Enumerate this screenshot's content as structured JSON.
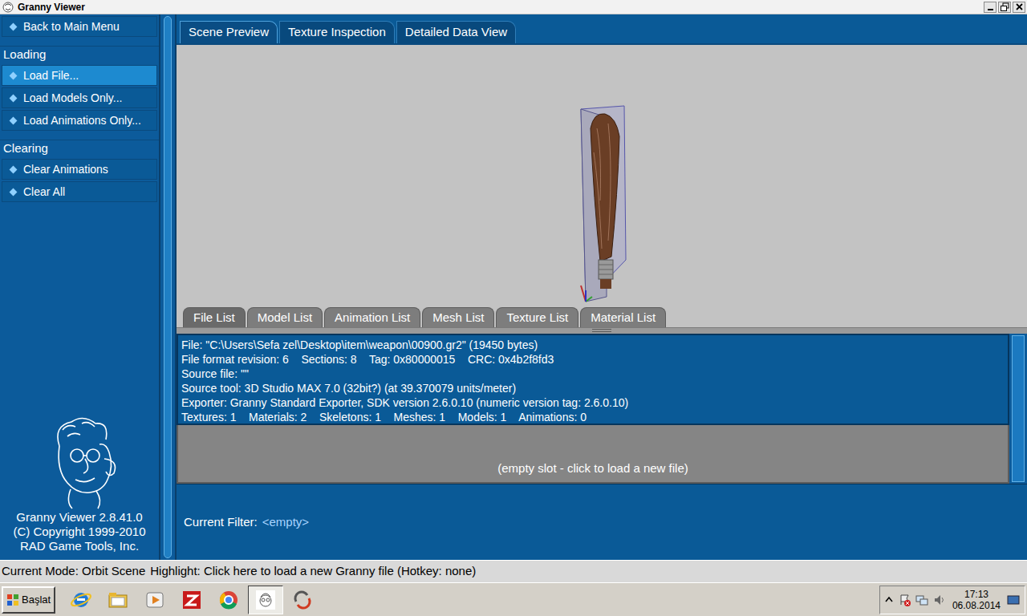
{
  "window": {
    "title": "Granny Viewer"
  },
  "sidebar": {
    "top": [
      {
        "label": "Back to Main Menu",
        "selected": false
      }
    ],
    "sections": [
      {
        "title": "Loading",
        "items": [
          {
            "label": "Load File...",
            "selected": true
          },
          {
            "label": "Load Models Only...",
            "selected": false
          },
          {
            "label": "Load Animations Only...",
            "selected": false
          }
        ]
      },
      {
        "title": "Clearing",
        "items": [
          {
            "label": "Clear Animations",
            "selected": false
          },
          {
            "label": "Clear All",
            "selected": false
          }
        ]
      }
    ],
    "about": [
      "Granny Viewer 2.8.41.0",
      "(C) Copyright 1999-2010",
      "RAD Game Tools, Inc."
    ]
  },
  "view_tabs": [
    {
      "label": "Scene Preview",
      "selected": true
    },
    {
      "label": "Texture Inspection",
      "selected": false
    },
    {
      "label": "Detailed Data View",
      "selected": false
    }
  ],
  "list_tabs": [
    {
      "label": "File List",
      "selected": true
    },
    {
      "label": "Model List",
      "selected": false
    },
    {
      "label": "Animation List",
      "selected": false
    },
    {
      "label": "Mesh List",
      "selected": false
    },
    {
      "label": "Texture List",
      "selected": false
    },
    {
      "label": "Material List",
      "selected": false
    }
  ],
  "file_info": [
    "File: \"C:\\Users\\Sefa zel\\Desktop\\item\\weapon\\00900.gr2\" (19450 bytes)",
    "File format revision: 6    Sections: 8    Tag: 0x80000015    CRC: 0x4b2f8fd3",
    "Source file: \"\"",
    "Source tool: 3D Studio MAX 7.0 (32bit?) (at 39.370079 units/meter)",
    "Exporter: Granny Standard Exporter, SDK version 2.6.0.10 (numeric version tag: 2.6.0.10)",
    "Textures: 1    Materials: 2    Skeletons: 1    Meshes: 1    Models: 1    Animations: 0"
  ],
  "empty_slot": "(empty slot - click to load a new file)",
  "filter": {
    "label": "Current Filter:",
    "value": "<empty>"
  },
  "status_bar": {
    "mode": "Current Mode: Orbit Scene",
    "highlight": "Highlight: Click here to load a new Granny file (Hotkey: none)"
  },
  "taskbar": {
    "start": "Başlat",
    "apps": [
      {
        "kind": "ie",
        "selected": false
      },
      {
        "kind": "explorer",
        "selected": false
      },
      {
        "kind": "media",
        "selected": false
      },
      {
        "kind": "filezilla",
        "selected": false
      },
      {
        "kind": "chrome",
        "selected": false
      },
      {
        "kind": "granny",
        "selected": true
      },
      {
        "kind": "sync",
        "selected": false
      }
    ],
    "clock": {
      "time": "17:13",
      "date": "06.08.2014"
    }
  }
}
